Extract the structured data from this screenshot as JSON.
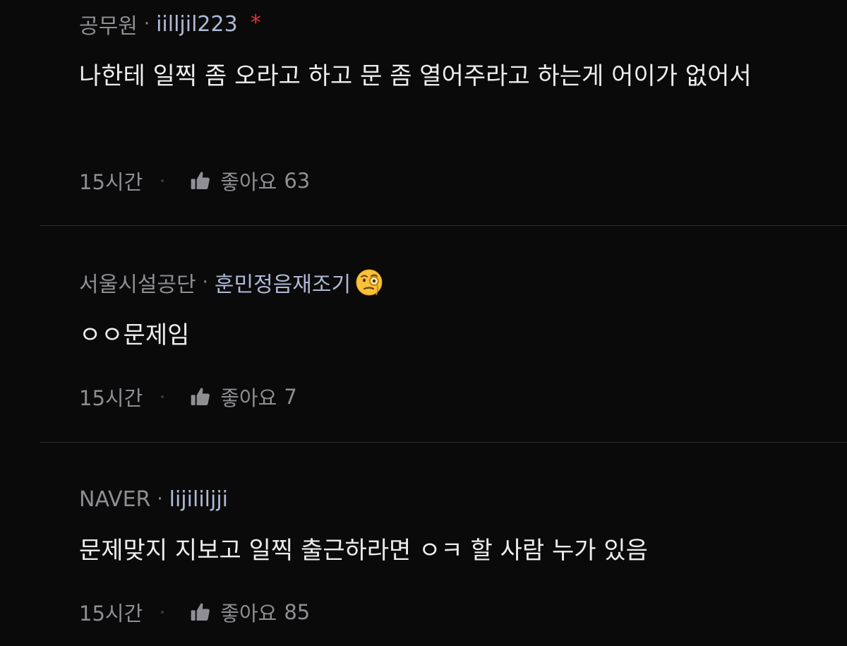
{
  "comments": [
    {
      "company": "공무원",
      "separator": "·",
      "author": "iilljil223",
      "badge": "*",
      "text": "나한테 일찍 좀 오라고 하고 문 좀 열어주라고 하는게 어이가 없어서",
      "time": "15시간",
      "like_label": "좋아요",
      "like_count": "63"
    },
    {
      "company": "서울시설공단",
      "separator": "·",
      "author": "훈민정음재조기",
      "author_emoji": "face-with-monocle-emoji",
      "text": "ㅇㅇ문제임",
      "time": "15시간",
      "like_label": "좋아요",
      "like_count": "7"
    },
    {
      "company": "NAVER",
      "separator": "·",
      "author": "lijililjji",
      "text": "문제맞지 지보고 일찍 출근하라면 ㅇㅋ 할 사람 누가 있음",
      "time": "15시간",
      "like_label": "좋아요",
      "like_count": "85"
    }
  ],
  "colors": {
    "background": "#0a0a0a",
    "text": "#ededed",
    "muted": "#8e8e93",
    "author": "#aeb9d6",
    "badge": "#e0322f",
    "divider": "#2c2c2e"
  },
  "icons": {
    "like": "thumbs-up-icon"
  }
}
